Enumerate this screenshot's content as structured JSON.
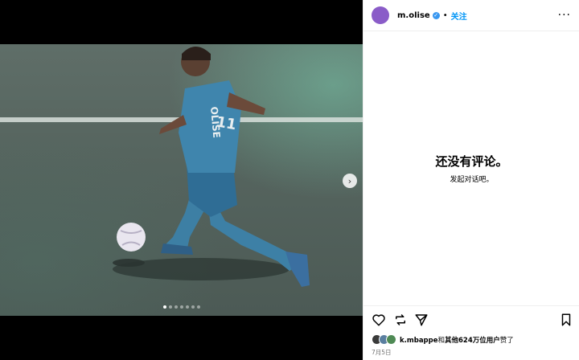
{
  "post": {
    "username": "m.olise",
    "verified_mark": "✓",
    "separator": "•",
    "follow_label": "关注",
    "more_label": "···"
  },
  "comments": {
    "empty_title": "还没有评论。",
    "empty_subtitle": "发起对话吧。"
  },
  "media": {
    "next_label": "›",
    "dots_total": 7,
    "dots_active": 1,
    "jersey_name": "OLISE",
    "jersey_number": "11"
  },
  "actions": [
    "heart-icon",
    "comment-icon",
    "share-icon",
    "bookmark-icon"
  ],
  "likes": {
    "user": "k.mbappe",
    "connector": "和",
    "others": "其他624万位用户",
    "suffix": "赞了"
  },
  "date": "7月5日",
  "colors": {
    "follow": "#0095f6",
    "avatar": "#8a5cc8",
    "verified": "#3897f0"
  }
}
